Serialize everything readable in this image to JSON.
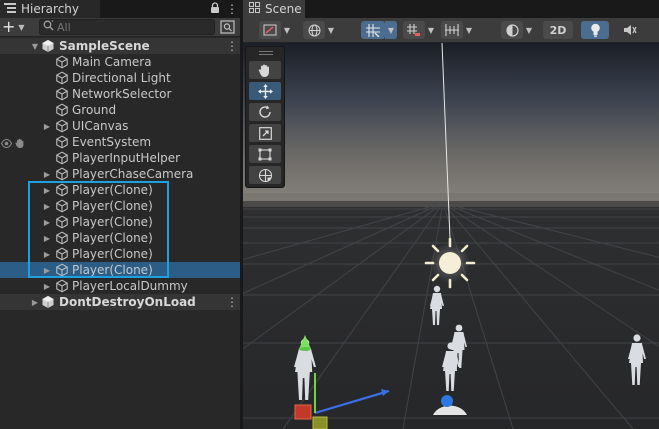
{
  "hierarchy": {
    "tab_label": "Hierarchy",
    "search_placeholder": "All",
    "add_label": "+",
    "items": [
      {
        "name": "SampleScene",
        "type": "scene",
        "depth": 0,
        "expanded": true
      },
      {
        "name": "Main Camera",
        "type": "object",
        "depth": 1,
        "has_children": false
      },
      {
        "name": "Directional Light",
        "type": "object",
        "depth": 1,
        "has_children": false
      },
      {
        "name": "NetworkSelector",
        "type": "object",
        "depth": 1,
        "has_children": false
      },
      {
        "name": "Ground",
        "type": "object",
        "depth": 1,
        "has_children": false
      },
      {
        "name": "UICanvas",
        "type": "object",
        "depth": 1,
        "has_children": true
      },
      {
        "name": "EventSystem",
        "type": "object",
        "depth": 1,
        "has_children": false,
        "hidden_toggle": true
      },
      {
        "name": "PlayerInputHelper",
        "type": "object",
        "depth": 1,
        "has_children": false
      },
      {
        "name": "PlayerChaseCamera",
        "type": "object",
        "depth": 1,
        "has_children": true
      },
      {
        "name": "Player(Clone)",
        "type": "object",
        "depth": 1,
        "has_children": true
      },
      {
        "name": "Player(Clone)",
        "type": "object",
        "depth": 1,
        "has_children": true
      },
      {
        "name": "Player(Clone)",
        "type": "object",
        "depth": 1,
        "has_children": true
      },
      {
        "name": "Player(Clone)",
        "type": "object",
        "depth": 1,
        "has_children": true
      },
      {
        "name": "Player(Clone)",
        "type": "object",
        "depth": 1,
        "has_children": true
      },
      {
        "name": "Player(Clone)",
        "type": "object",
        "depth": 1,
        "has_children": true,
        "selected": true
      },
      {
        "name": "PlayerLocalDummy",
        "type": "object",
        "depth": 1,
        "has_children": true
      },
      {
        "name": "DontDestroyOnLoad",
        "type": "scene",
        "depth": 0,
        "expanded": false
      }
    ]
  },
  "scene": {
    "tab_label": "Scene",
    "toolbar": {
      "mode_2d_label": "2D"
    }
  },
  "colors": {
    "selection": "#2c5d87",
    "highlight_box": "#1ea0e0",
    "panel_bg": "#282828",
    "toolbar_bg": "#3c3c3c"
  }
}
